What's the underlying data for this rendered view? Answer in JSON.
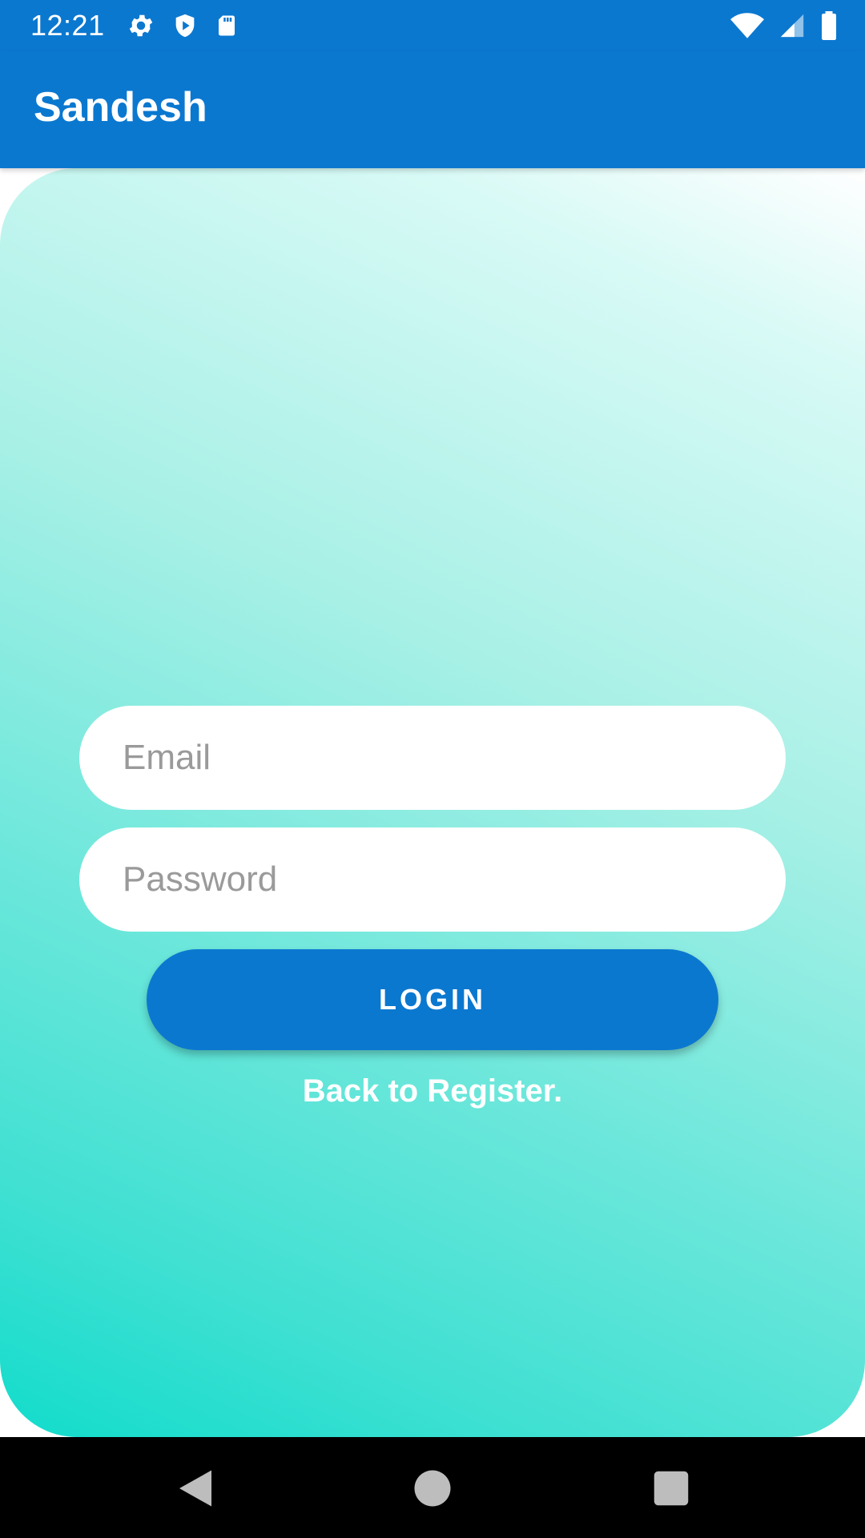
{
  "status_bar": {
    "time": "12:21",
    "icons_left": [
      "settings-gear-icon",
      "shield-icon",
      "sd-card-icon"
    ],
    "icons_right": [
      "wifi-icon",
      "cell-signal-icon",
      "battery-icon"
    ]
  },
  "app_bar": {
    "title": "Sandesh",
    "color": "#0B78D0"
  },
  "form": {
    "email": {
      "placeholder": "Email",
      "value": ""
    },
    "password": {
      "placeholder": "Password",
      "value": ""
    },
    "login_label": "LOGIN",
    "back_link_label": "Back to Register."
  },
  "nav_bar": {
    "buttons": [
      "back-triangle-icon",
      "home-circle-icon",
      "recents-square-icon"
    ]
  }
}
